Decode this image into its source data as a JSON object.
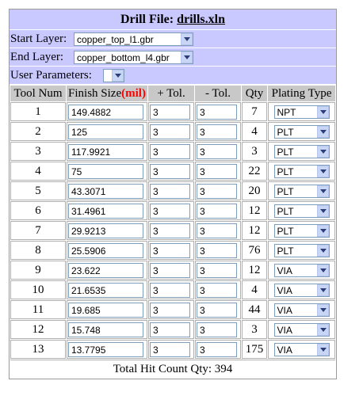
{
  "header": {
    "label": "Drill File: ",
    "filename": "drills.xln"
  },
  "start_layer": {
    "label": "Start Layer:",
    "value": "copper_top_l1.gbr"
  },
  "end_layer": {
    "label": "End Layer:",
    "value": "copper_bottom_l4.gbr"
  },
  "user_params": {
    "label": "User Parameters:",
    "value": ""
  },
  "columns": {
    "tool_num": "Tool Num",
    "finish_size": "Finish Size",
    "unit": "(mil)",
    "plus_tol": "+ Tol.",
    "minus_tol": "- Tol.",
    "qty": "Qty",
    "plating": "Plating Type"
  },
  "rows": [
    {
      "tool": "1",
      "size": "149.4882",
      "plus": "3",
      "minus": "3",
      "qty": "7",
      "plating": "NPT"
    },
    {
      "tool": "2",
      "size": "125",
      "plus": "3",
      "minus": "3",
      "qty": "4",
      "plating": "PLT"
    },
    {
      "tool": "3",
      "size": "117.9921",
      "plus": "3",
      "minus": "3",
      "qty": "3",
      "plating": "PLT"
    },
    {
      "tool": "4",
      "size": "75",
      "plus": "3",
      "minus": "3",
      "qty": "22",
      "plating": "PLT"
    },
    {
      "tool": "5",
      "size": "43.3071",
      "plus": "3",
      "minus": "3",
      "qty": "20",
      "plating": "PLT"
    },
    {
      "tool": "6",
      "size": "31.4961",
      "plus": "3",
      "minus": "3",
      "qty": "12",
      "plating": "PLT"
    },
    {
      "tool": "7",
      "size": "29.9213",
      "plus": "3",
      "minus": "3",
      "qty": "12",
      "plating": "PLT"
    },
    {
      "tool": "8",
      "size": "25.5906",
      "plus": "3",
      "minus": "3",
      "qty": "76",
      "plating": "PLT"
    },
    {
      "tool": "9",
      "size": "23.622",
      "plus": "3",
      "minus": "3",
      "qty": "12",
      "plating": "VIA"
    },
    {
      "tool": "10",
      "size": "21.6535",
      "plus": "3",
      "minus": "3",
      "qty": "4",
      "plating": "VIA"
    },
    {
      "tool": "11",
      "size": "19.685",
      "plus": "3",
      "minus": "3",
      "qty": "44",
      "plating": "VIA"
    },
    {
      "tool": "12",
      "size": "15.748",
      "plus": "3",
      "minus": "3",
      "qty": "3",
      "plating": "VIA"
    },
    {
      "tool": "13",
      "size": "13.7795",
      "plus": "3",
      "minus": "3",
      "qty": "175",
      "plating": "VIA"
    }
  ],
  "total": "Total Hit Count Qty: 394",
  "colors": {
    "header_bg": "#c9c9ff",
    "column_header_bg": "#c8c8c8",
    "unit_text": "#ff0000"
  },
  "icons": {
    "dropdown": "chevron-down-icon"
  }
}
